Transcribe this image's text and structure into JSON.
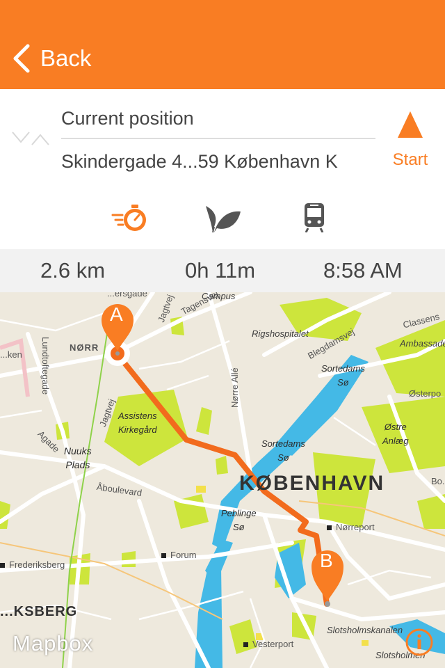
{
  "nav": {
    "back_label": "Back"
  },
  "route": {
    "from": "Current position",
    "to": "Skindergade 4...59 København K",
    "start_label": "Start"
  },
  "modes": [
    "fast-icon",
    "leaf-icon",
    "train-icon"
  ],
  "stats": {
    "distance": "2.6 km",
    "duration": "0h 11m",
    "arrival": "8:58 AM"
  },
  "map": {
    "streets": [
      "...ersgade",
      "Jagtvej",
      "Tagensvej",
      "Campus",
      "Rigshospitalet",
      "Blegdamsvej",
      "Classens",
      "Ambassade",
      "...ken",
      "NØRR",
      "Lundtoftegade",
      "Nørre Allé",
      "Jagtvej",
      "Østerpo",
      "Agade",
      "Åboulevard",
      "Forum",
      "Frederiksberg",
      "...KSBERG",
      "Nørreport",
      "Vesterport",
      "Slotsholmskanalen",
      "Slotsholmen",
      "Bo..."
    ],
    "labels": {
      "assistens": "Assistens\nKirkegård",
      "nuuks": "Nuuks\nPlads",
      "sortedams1": "Sortedams\nSø",
      "sortedams2": "Sortedams\nSø",
      "ostre": "Østre\nAnlæg",
      "peblinge": "Peblinge\nSø",
      "city": "KØBENHAVN"
    },
    "markers": {
      "a": "A",
      "b": "B"
    },
    "attribution": "Mapbox"
  },
  "colors": {
    "accent": "#f97d23",
    "park": "#cde53c",
    "water": "#44b9e6",
    "route": "#f26b1d"
  }
}
